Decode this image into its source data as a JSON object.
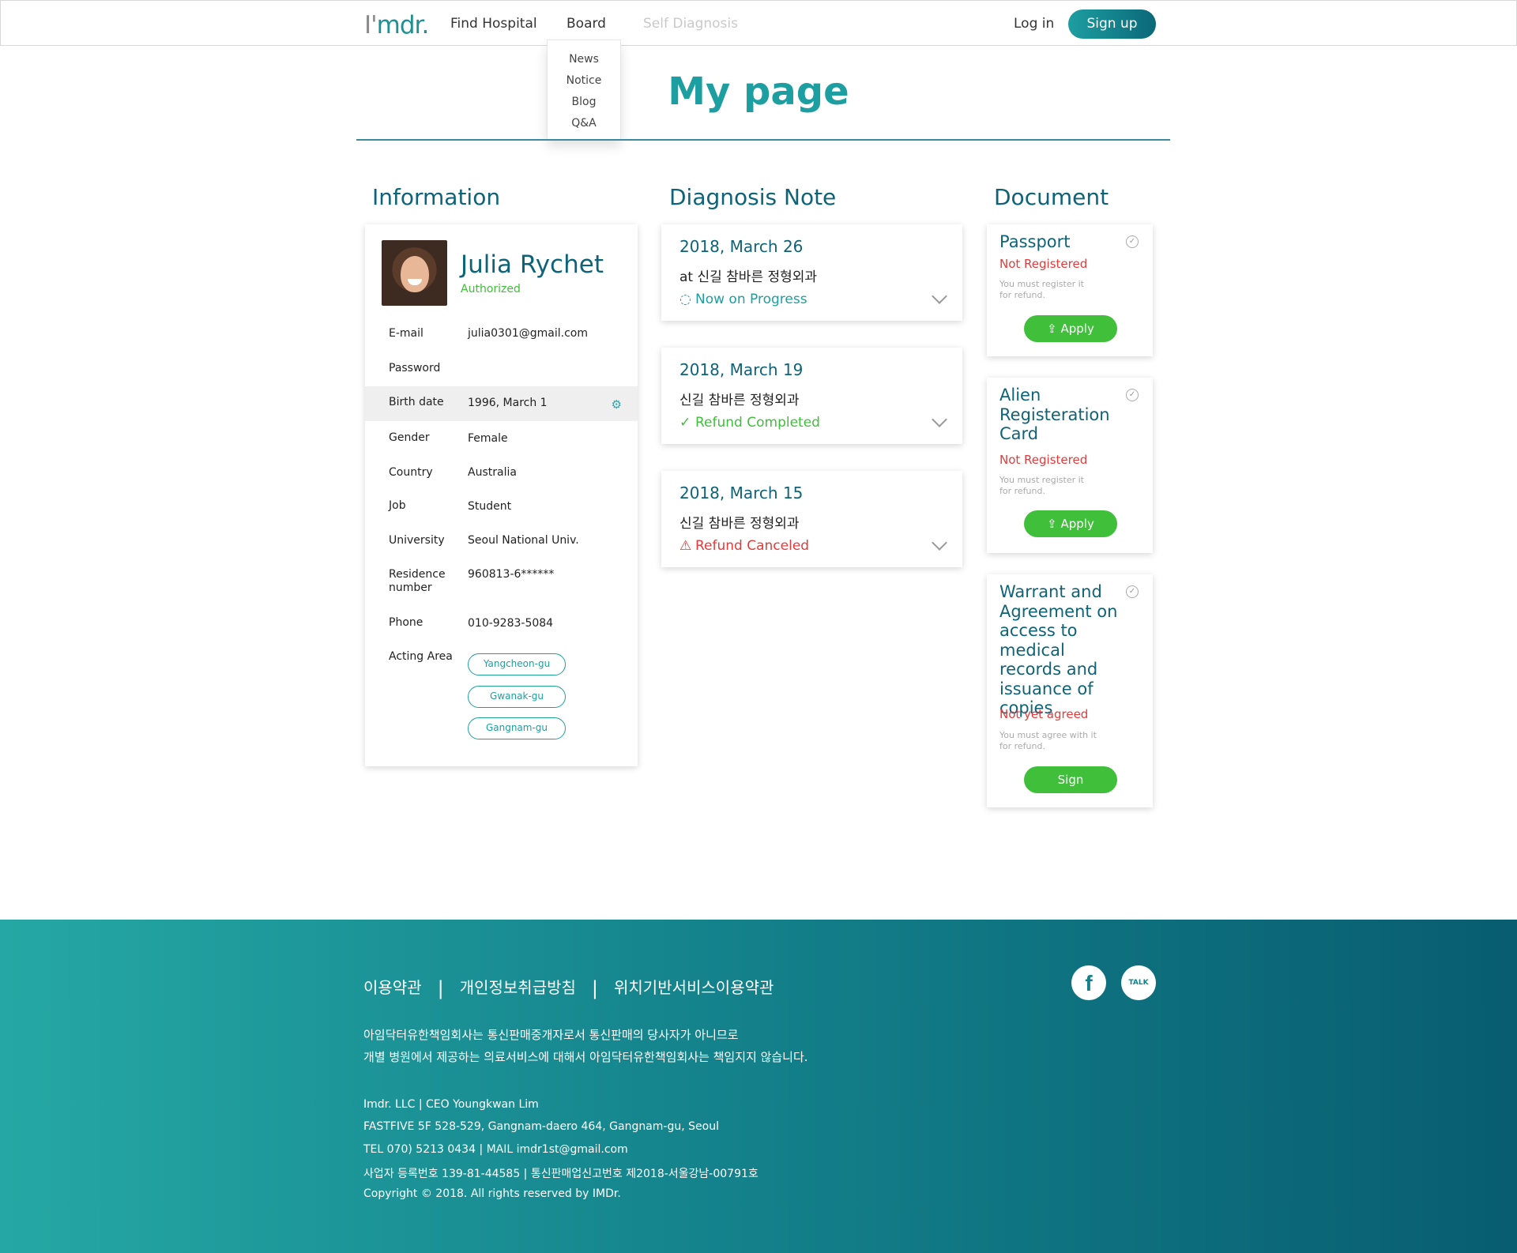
{
  "nav": {
    "logo_i": "I'",
    "logo_rest": "mdr.",
    "links": [
      "Find Hospital",
      "Board",
      "Self Diagnosis"
    ],
    "login": "Log in",
    "signup": "Sign up",
    "board_menu": [
      "News",
      "Notice",
      "Blog",
      "Q&A"
    ]
  },
  "page": {
    "title": "My page",
    "sections": [
      "Information",
      "Diagnosis Note",
      "Document"
    ]
  },
  "profile": {
    "name": "Julia Rychet",
    "status": "Authorized",
    "rows": [
      {
        "label": "E-mail",
        "value": "julia0301@gmail.com"
      },
      {
        "label": "Password",
        "value": ""
      },
      {
        "label": "Birth date",
        "value": "1996, March 1"
      },
      {
        "label": "Gender",
        "value": "Female"
      },
      {
        "label": "Country",
        "value": "Australia"
      },
      {
        "label": "Job",
        "value": "Student"
      },
      {
        "label": "University",
        "value": "Seoul National Univ."
      },
      {
        "label": "Residence",
        "label2": "number",
        "value": "960813-6******"
      },
      {
        "label": "Phone",
        "value": "010-9283-5084"
      },
      {
        "label": "Acting Area",
        "value": ""
      }
    ],
    "areas": [
      "Yangcheon-gu",
      "Gwanak-gu",
      "Gangnam-gu"
    ]
  },
  "diagnosis": [
    {
      "date": "2018, March 26",
      "place": "at 신길 참바른 정형외과",
      "status": "Now on Progress",
      "type": "progress"
    },
    {
      "date": "2018, March 19",
      "place": "신길 참바른 정형외과",
      "status": "Refund Completed",
      "type": "complete"
    },
    {
      "date": "2018, March 15",
      "place": "신길 참바른 정형외과",
      "status": "Refund Canceled",
      "type": "cancel"
    }
  ],
  "documents": [
    {
      "title": "Passport",
      "state": "Not Registered",
      "note": "You must register it for refund.",
      "button": "Apply"
    },
    {
      "title": "Alien Registeration Card",
      "state": "Not Registered",
      "note": "You must register it for refund.",
      "button": "Apply"
    },
    {
      "title": "Warrant and Agreement on access to medical records and issuance of copies",
      "state": "Not yet agreed",
      "note": "You must agree with it for refund.",
      "button": "Sign"
    }
  ],
  "footer": {
    "links": [
      "이용약관",
      "개인정보취급방침",
      "위치기반서비스이용약관"
    ],
    "notice": [
      "아임닥터유한책임회사는 통신판매중개자로서 통신판매의 당사자가 아니므로",
      "개별 병원에서 제공하는 의료서비스에 대해서 아임닥터유한책임회사는 책임지지 않습니다."
    ],
    "legal": [
      "Imdr. LLC | CEO Youngkwan Lim",
      "FASTFIVE 5F 528-529, Gangnam-daero 464, Gangnam-gu, Seoul",
      "TEL 070) 5213 0434 | MAIL  imdr1st@gmail.com",
      "사업자 등록번호 139-81-44585 | 통신판매업신고번호 제2018-서울강남-00791호",
      "Copyright © 2018. All rights reserved by IMDr."
    ],
    "social_fb": "f",
    "social_talk": "TALK"
  },
  "colors": {
    "teal": "#1d9ea1",
    "dark_teal": "#0e6378",
    "green": "#3fbf3a",
    "red": "#e53a3a"
  },
  "icons": [
    "gear-icon",
    "loading-icon",
    "check-circle-icon",
    "warning-icon",
    "chevron-down-icon",
    "upload-icon",
    "facebook-icon",
    "kakaotalk-icon"
  ]
}
